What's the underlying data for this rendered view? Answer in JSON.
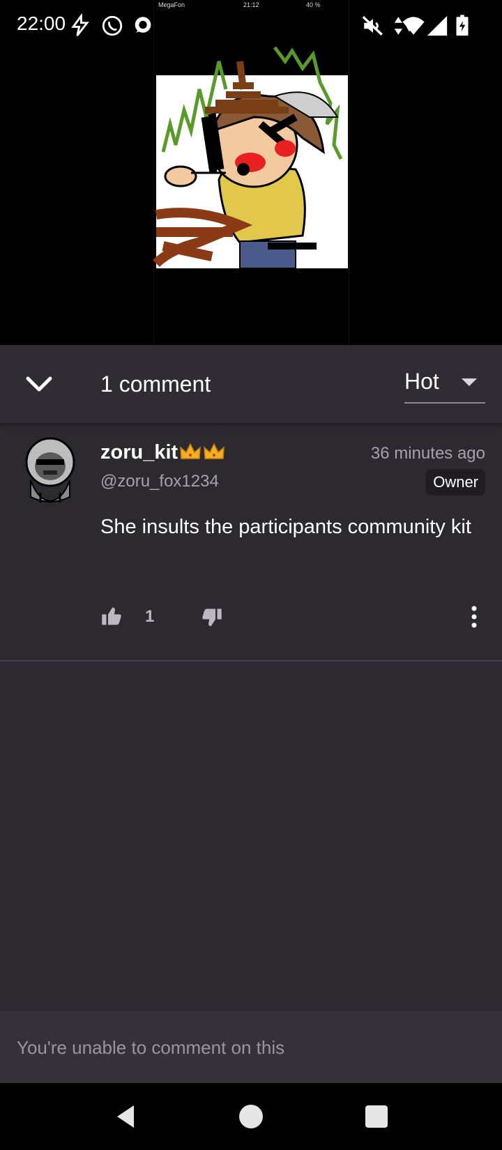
{
  "status_bar": {
    "time": "22:00",
    "icons": [
      "flash-icon",
      "whatsapp-icon",
      "chat-bubble-icon",
      "dot-icon",
      "mute-icon",
      "data-arrows-icon",
      "wifi-icon",
      "signal-icon",
      "battery-charging-icon"
    ]
  },
  "embedded_screenshot": {
    "carrier": "MegaFon",
    "time": "21:12",
    "battery": "40 %"
  },
  "comments_header": {
    "count_label": "1 comment",
    "sort_value": "Hot"
  },
  "comment": {
    "username": "zoru_kit",
    "crowns": "👑👑",
    "handle": "@zoru_fox1234",
    "timestamp": "36 minutes ago",
    "badge": "Owner",
    "text": "She insults the participants community kit",
    "likes": "1"
  },
  "footer": {
    "disabled_message": "You're unable to comment on this"
  },
  "colors": {
    "background": "#2c292f",
    "header": "#2f2c33",
    "muted_text": "#a6a2aa"
  }
}
